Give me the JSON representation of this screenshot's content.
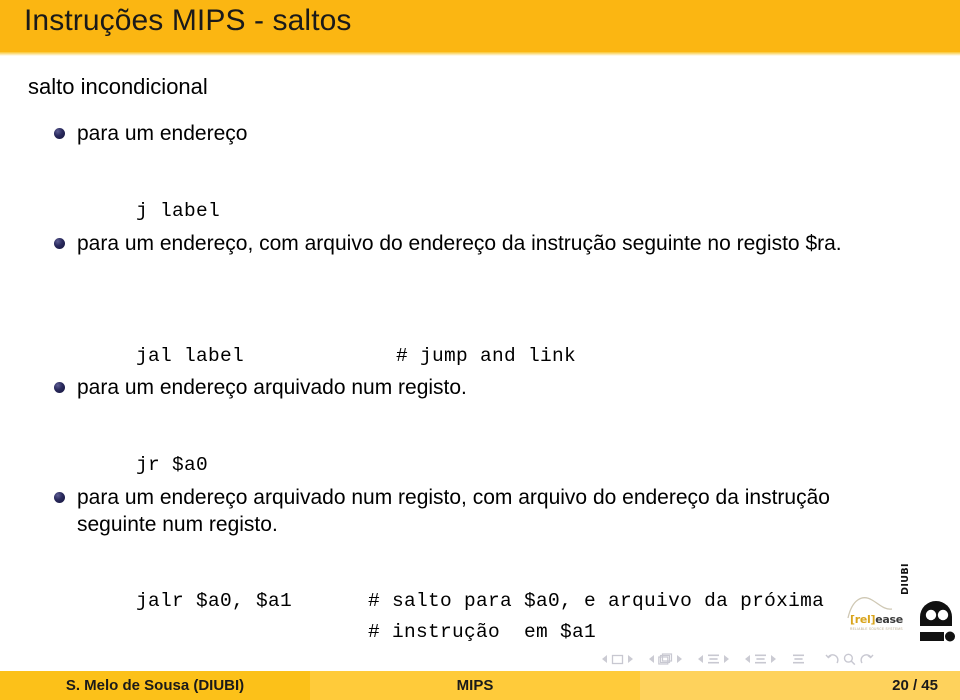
{
  "slide": {
    "title": "Instruções MIPS - saltos",
    "block_title": "salto incondicional",
    "bullets": [
      {
        "text": "para um endereço"
      },
      {
        "text": "para um endereço, com arquivo do endereço da instrução seguinte no registo $ra."
      },
      {
        "text": "para um endereço arquivado num registo."
      },
      {
        "text": "para um endereço arquivado num registo, com arquivo do endereço da instrução seguinte num registo."
      }
    ],
    "code": [
      {
        "instruction": "j label",
        "comment": ""
      },
      {
        "instruction": "jal label",
        "comment": "# jump and link"
      },
      {
        "instruction": "jr $a0",
        "comment": ""
      },
      {
        "instruction": "jalr $a0, $a1",
        "comment": "# salto para $a0, e arquivo da próxima"
      },
      {
        "instruction": "",
        "comment": "# instrução  em $a1"
      }
    ]
  },
  "navigation": {
    "groups": [
      {
        "name": "frame-navigation",
        "glyph": "square"
      },
      {
        "name": "slide-navigation",
        "glyph": "stack"
      },
      {
        "name": "subsection-navigation",
        "glyph": "lines"
      },
      {
        "name": "section-navigation",
        "glyph": "lines"
      }
    ],
    "doc_icon": "document-icon",
    "back_icon": "back-icon",
    "search_icon": "search-icon",
    "forward_icon": "forward-icon"
  },
  "logos": {
    "release": {
      "bracket_open": "[rel]",
      "word": "ease",
      "subtitle": "RELIABLE SOURCE SYSTEMS"
    },
    "diubi": {
      "label": "DIUBI"
    }
  },
  "footer": {
    "author": "S. Melo de Sousa  (DIUBI)",
    "subject": "MIPS",
    "page": "20 / 45"
  },
  "colors": {
    "title_bar": "#fbb612",
    "footer_author": "#fcc119",
    "footer_subject": "#ffcb3a",
    "footer_page": "#fed25c",
    "bullet": "#14143a"
  }
}
